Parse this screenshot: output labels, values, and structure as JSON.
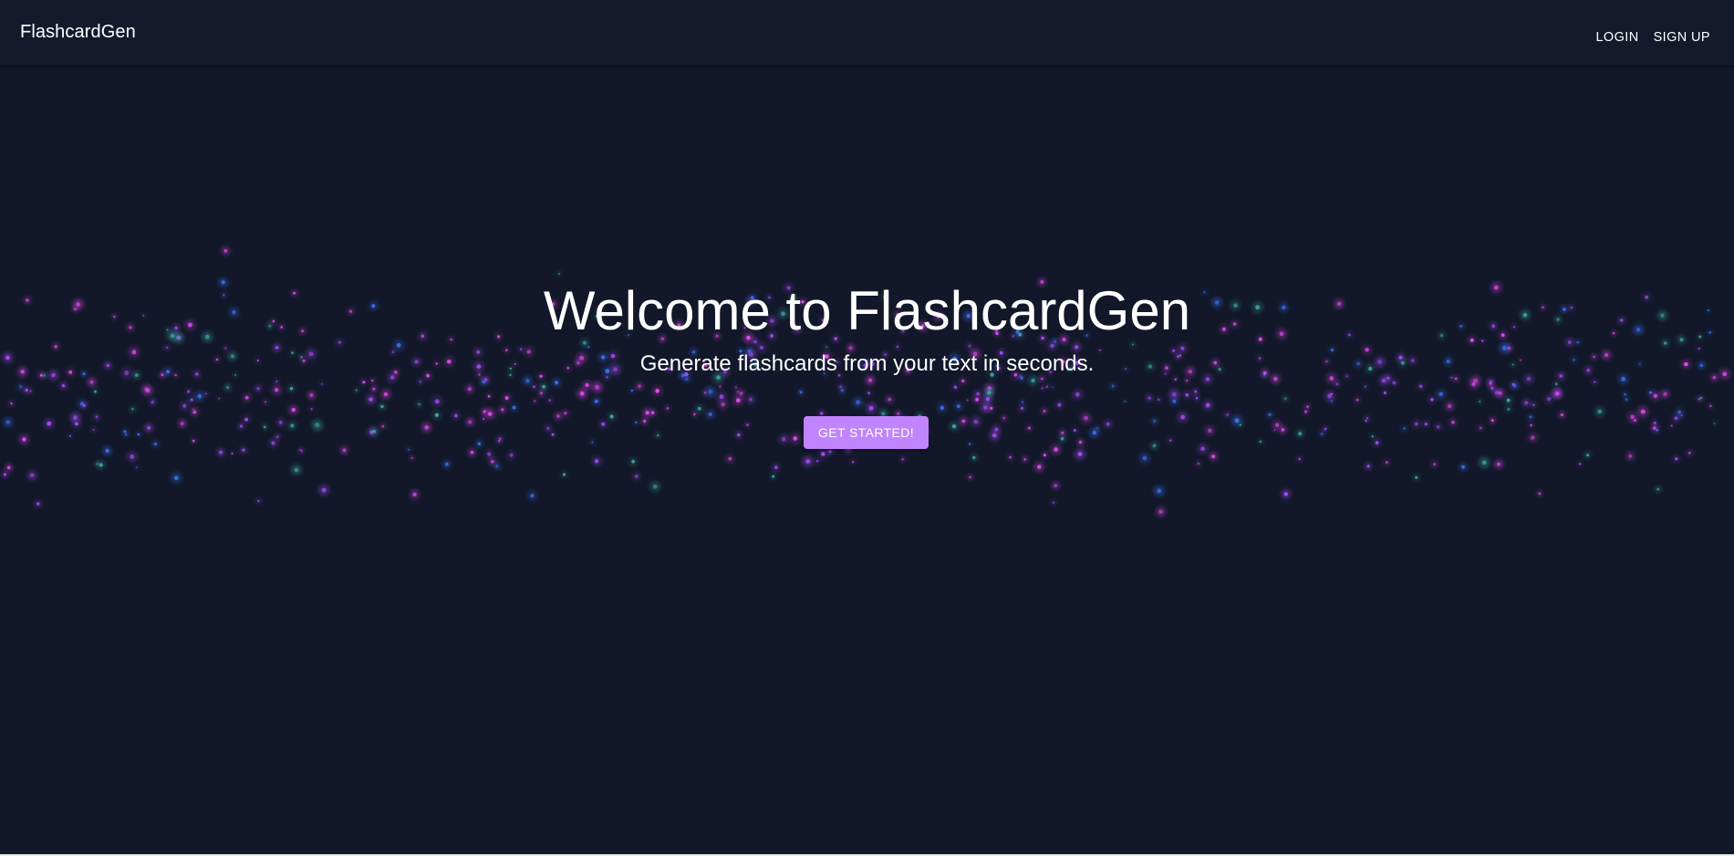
{
  "header": {
    "brand": "FlashcardGen",
    "nav": {
      "login_label": "LOGIN",
      "signup_label": "SIGN UP"
    }
  },
  "hero": {
    "title": "Welcome to FlashcardGen",
    "subtitle": "Generate flashcards from your text in seconds.",
    "cta_label": "GET STARTED!"
  },
  "colors": {
    "background": "#121829",
    "appbar": "#141a2b",
    "accent": "#c084fc",
    "particle_pink": "#e24bf0",
    "particle_purple": "#a34cf2",
    "particle_blue": "#3b6ff0",
    "particle_teal": "#3ea8a8"
  }
}
